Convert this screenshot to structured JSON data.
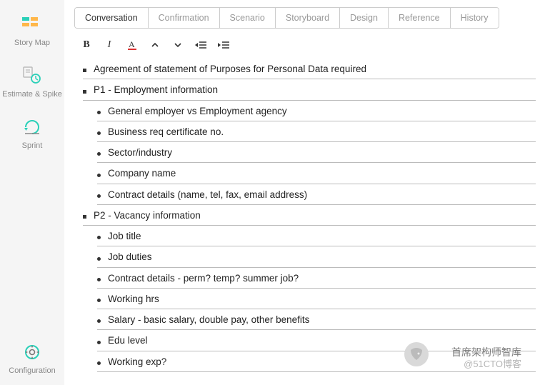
{
  "sidebar": {
    "items": [
      {
        "label": "Story Map"
      },
      {
        "label": "Estimate & Spike"
      },
      {
        "label": "Sprint"
      }
    ],
    "bottom": {
      "label": "Configuration"
    }
  },
  "tabs": [
    {
      "label": "Conversation",
      "active": true
    },
    {
      "label": "Confirmation"
    },
    {
      "label": "Scenario"
    },
    {
      "label": "Storyboard"
    },
    {
      "label": "Design"
    },
    {
      "label": "Reference"
    },
    {
      "label": "History"
    }
  ],
  "content": {
    "items": [
      {
        "level": 0,
        "text": "Agreement of statement of Purposes for Personal Data required"
      },
      {
        "level": 0,
        "text": "P1 - Employment information"
      },
      {
        "level": 1,
        "text": "General employer vs Employment agency"
      },
      {
        "level": 1,
        "text": "Business req certificate no."
      },
      {
        "level": 1,
        "text": "Sector/industry"
      },
      {
        "level": 1,
        "text": "Company name"
      },
      {
        "level": 1,
        "text": "Contract details (name, tel, fax, email address)"
      },
      {
        "level": 0,
        "text": "P2 - Vacancy information"
      },
      {
        "level": 1,
        "text": "Job title"
      },
      {
        "level": 1,
        "text": "Job duties"
      },
      {
        "level": 1,
        "text": "Contract details - perm? temp? summer job?"
      },
      {
        "level": 1,
        "text": "Working hrs"
      },
      {
        "level": 1,
        "text": "Salary - basic salary, double pay, other benefits"
      },
      {
        "level": 1,
        "text": "Edu level"
      },
      {
        "level": 1,
        "text": "Working exp?"
      }
    ]
  },
  "watermark": {
    "line1": "首席架构师智库",
    "line2": "@51CTO博客"
  }
}
